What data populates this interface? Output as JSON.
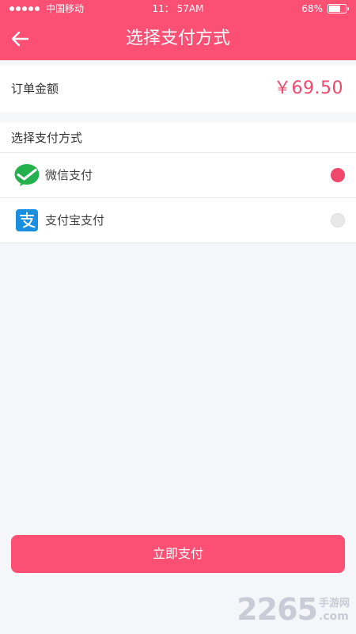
{
  "status_bar": {
    "carrier": "中国移动",
    "time": "11： 57AM",
    "battery_text": "68%",
    "battery_level": 0.68
  },
  "nav": {
    "title": "选择支付方式"
  },
  "order": {
    "amount_label": "订单金额",
    "amount_value": "￥69.50"
  },
  "payment": {
    "section_title": "选择支付方式",
    "options": [
      {
        "label": "微信支付",
        "icon": "wechat-pay-icon",
        "selected": true
      },
      {
        "label": "支付宝支付",
        "icon": "alipay-icon",
        "selected": false
      }
    ]
  },
  "pay_button": {
    "label": "立即支付"
  },
  "watermark": {
    "number": "2265",
    "text": "手游网",
    "suffix": ".com"
  },
  "colors": {
    "brand": "#fb4f74",
    "accent": "#f0476d",
    "wechat": "#22b14c",
    "alipay": "#1a8fe0"
  }
}
